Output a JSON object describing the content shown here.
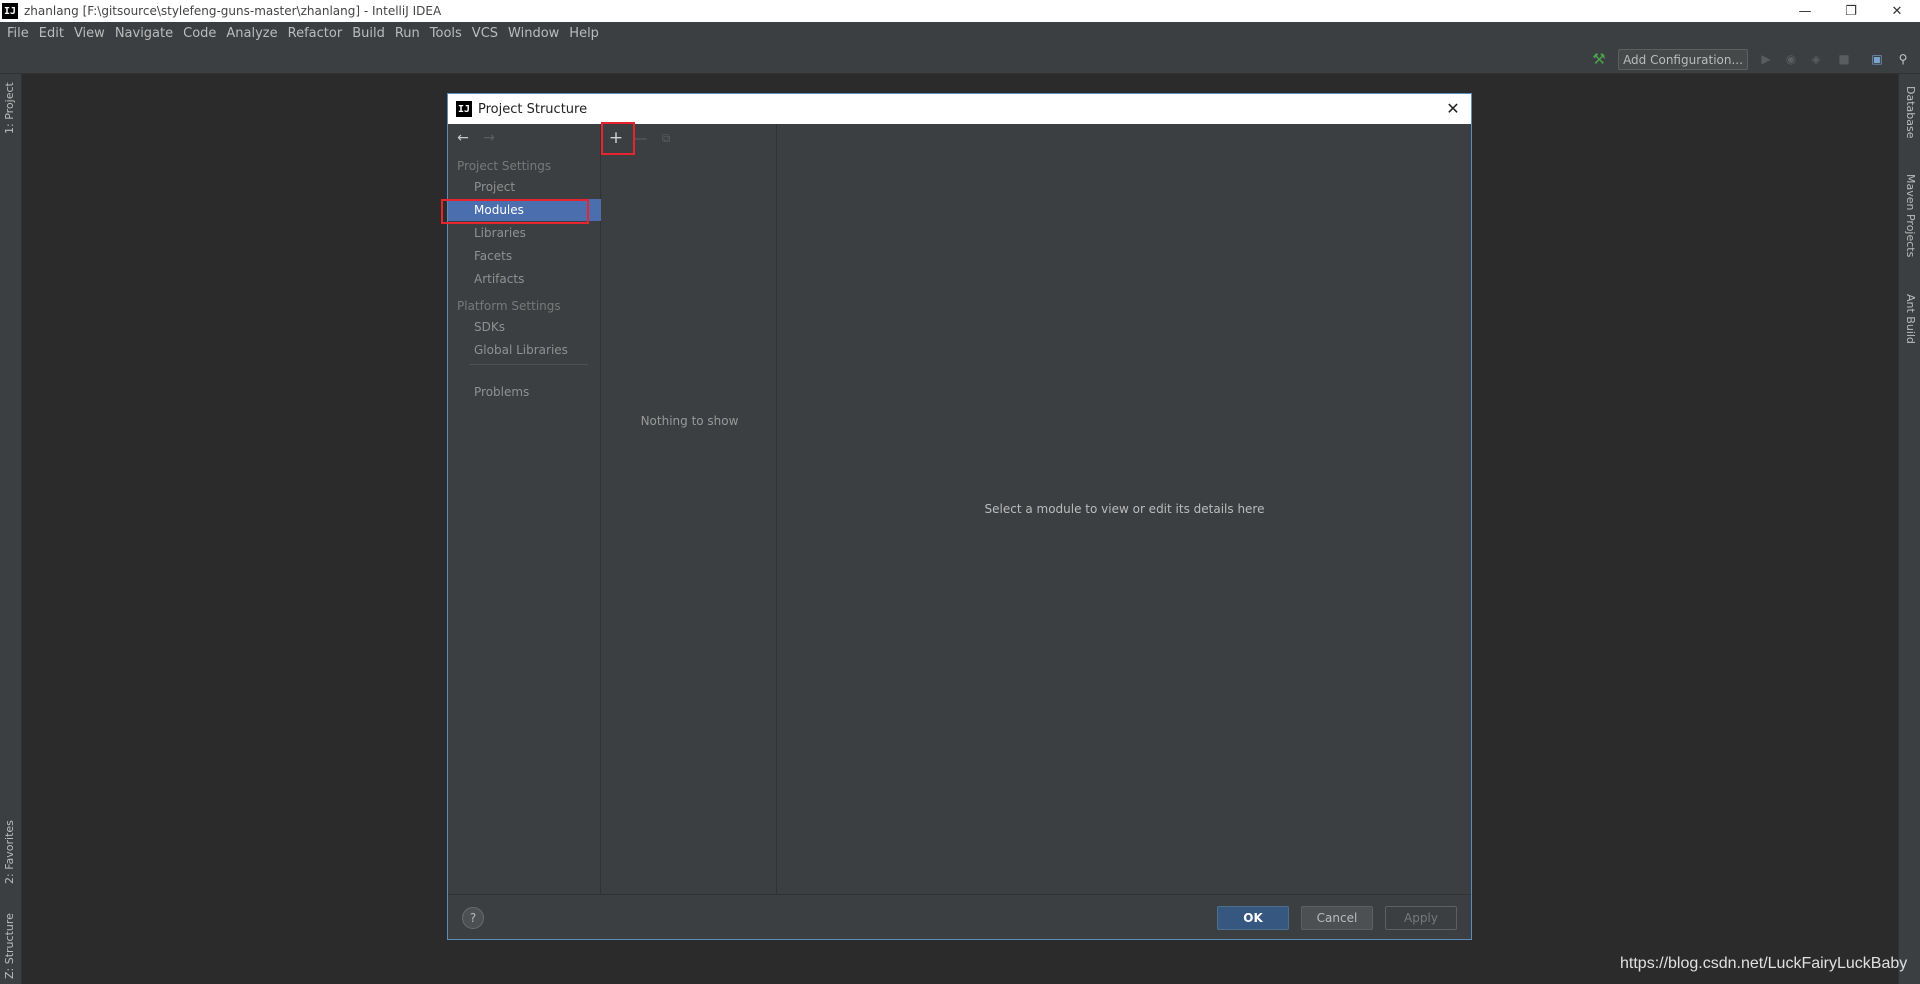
{
  "window": {
    "title": "zhanlang [F:\\gitsource\\stylefeng-guns-master\\zhanlang] - IntelliJ IDEA",
    "logo_text": "IJ"
  },
  "menu": [
    "File",
    "Edit",
    "View",
    "Navigate",
    "Code",
    "Analyze",
    "Refactor",
    "Build",
    "Run",
    "Tools",
    "VCS",
    "Window",
    "Help"
  ],
  "toolbar": {
    "add_configuration_label": "Add Configuration..."
  },
  "side_tabs": {
    "left": [
      "1: Project",
      "2: Favorites",
      "Z: Structure"
    ],
    "right": [
      "Database",
      "Maven Projects",
      "Ant Build"
    ]
  },
  "dialog": {
    "title": "Project Structure",
    "nav": {
      "project_settings_header": "Project Settings",
      "project_settings_items": [
        "Project",
        "Modules",
        "Libraries",
        "Facets",
        "Artifacts"
      ],
      "selected": "Modules",
      "platform_settings_header": "Platform Settings",
      "platform_settings_items": [
        "SDKs",
        "Global Libraries"
      ],
      "problems": "Problems"
    },
    "list": {
      "empty_text": "Nothing to show"
    },
    "detail": {
      "empty_text": "Select a module to view or edit its details here"
    },
    "buttons": {
      "help": "?",
      "ok": "OK",
      "cancel": "Cancel",
      "apply": "Apply"
    }
  },
  "watermark": "https://blog.csdn.net/LuckFairyLuckBaby",
  "colors": {
    "background": "#2b2b2b",
    "panel": "#3c3f41",
    "selection": "#4b6eaf",
    "highlight_box": "#e8252f",
    "ok_button": "#365880"
  }
}
